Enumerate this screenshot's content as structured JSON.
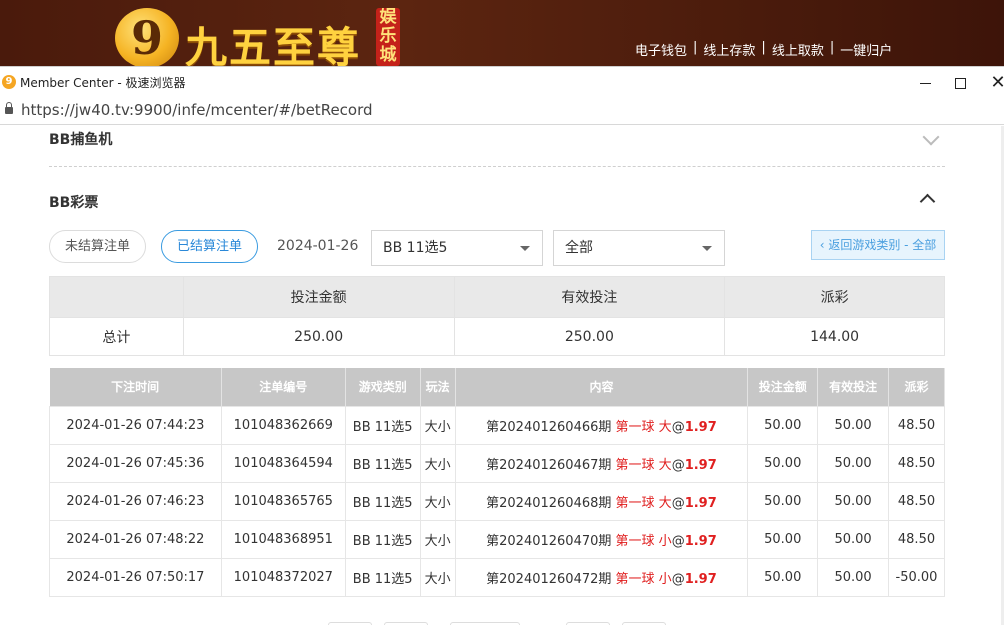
{
  "site": {
    "brand": "九五至尊",
    "brand_sub": "娱乐城",
    "links": [
      "电子钱包",
      "线上存款",
      "线上取款",
      "一键归户"
    ]
  },
  "window": {
    "title": "Member Center - 极速浏览器",
    "url": "https://jw40.tv:9900/infe/mcenter/#/betRecord"
  },
  "sections": {
    "fish": "BB捕鱼机",
    "lottery": "BB彩票"
  },
  "filters": {
    "unsettled": "未结算注单",
    "settled": "已结算注单",
    "date": "2024-01-26",
    "game": "BB 11选5",
    "scope": "全部",
    "back": "‹ 返回游戏类别 - 全部"
  },
  "summary": {
    "headers": [
      "投注金额",
      "有效投注",
      "派彩"
    ],
    "row_label": "总计",
    "values": [
      "250.00",
      "250.00",
      "144.00"
    ]
  },
  "table": {
    "headers": [
      "下注时间",
      "注单编号",
      "游戏类别",
      "玩法",
      "内容",
      "投注金额",
      "有效投注",
      "派彩"
    ],
    "rows": [
      {
        "time": "2024-01-26 07:44:23",
        "id": "101048362669",
        "game": "BB 11选5",
        "play": "大小",
        "period": "第202401260466期",
        "pick": "第一球 大",
        "odds": "1.97",
        "bet": "50.00",
        "valid": "50.00",
        "payout": "48.50"
      },
      {
        "time": "2024-01-26 07:45:36",
        "id": "101048364594",
        "game": "BB 11选5",
        "play": "大小",
        "period": "第202401260467期",
        "pick": "第一球 大",
        "odds": "1.97",
        "bet": "50.00",
        "valid": "50.00",
        "payout": "48.50"
      },
      {
        "time": "2024-01-26 07:46:23",
        "id": "101048365765",
        "game": "BB 11选5",
        "play": "大小",
        "period": "第202401260468期",
        "pick": "第一球 大",
        "odds": "1.97",
        "bet": "50.00",
        "valid": "50.00",
        "payout": "48.50"
      },
      {
        "time": "2024-01-26 07:48:22",
        "id": "101048368951",
        "game": "BB 11选5",
        "play": "大小",
        "period": "第202401260470期",
        "pick": "第一球 小",
        "odds": "1.97",
        "bet": "50.00",
        "valid": "50.00",
        "payout": "48.50"
      },
      {
        "time": "2024-01-26 07:50:17",
        "id": "101048372027",
        "game": "BB 11选5",
        "play": "大小",
        "period": "第202401260472期",
        "pick": "第一球 小",
        "odds": "1.97",
        "bet": "50.00",
        "valid": "50.00",
        "payout": "-50.00"
      }
    ]
  },
  "icons": {
    "logo": "logo-badge-icon",
    "browser": "browser-app-icon",
    "lock": "lock-icon",
    "collapse": "chevron-up-icon",
    "expand": "chevron-down-icon",
    "caret": "caret-down-icon"
  },
  "colors": {
    "accent": "#2a88d8",
    "negative": "#e02020",
    "header_bg": "#4a1a0c",
    "table_header": "#c7c7c7"
  }
}
